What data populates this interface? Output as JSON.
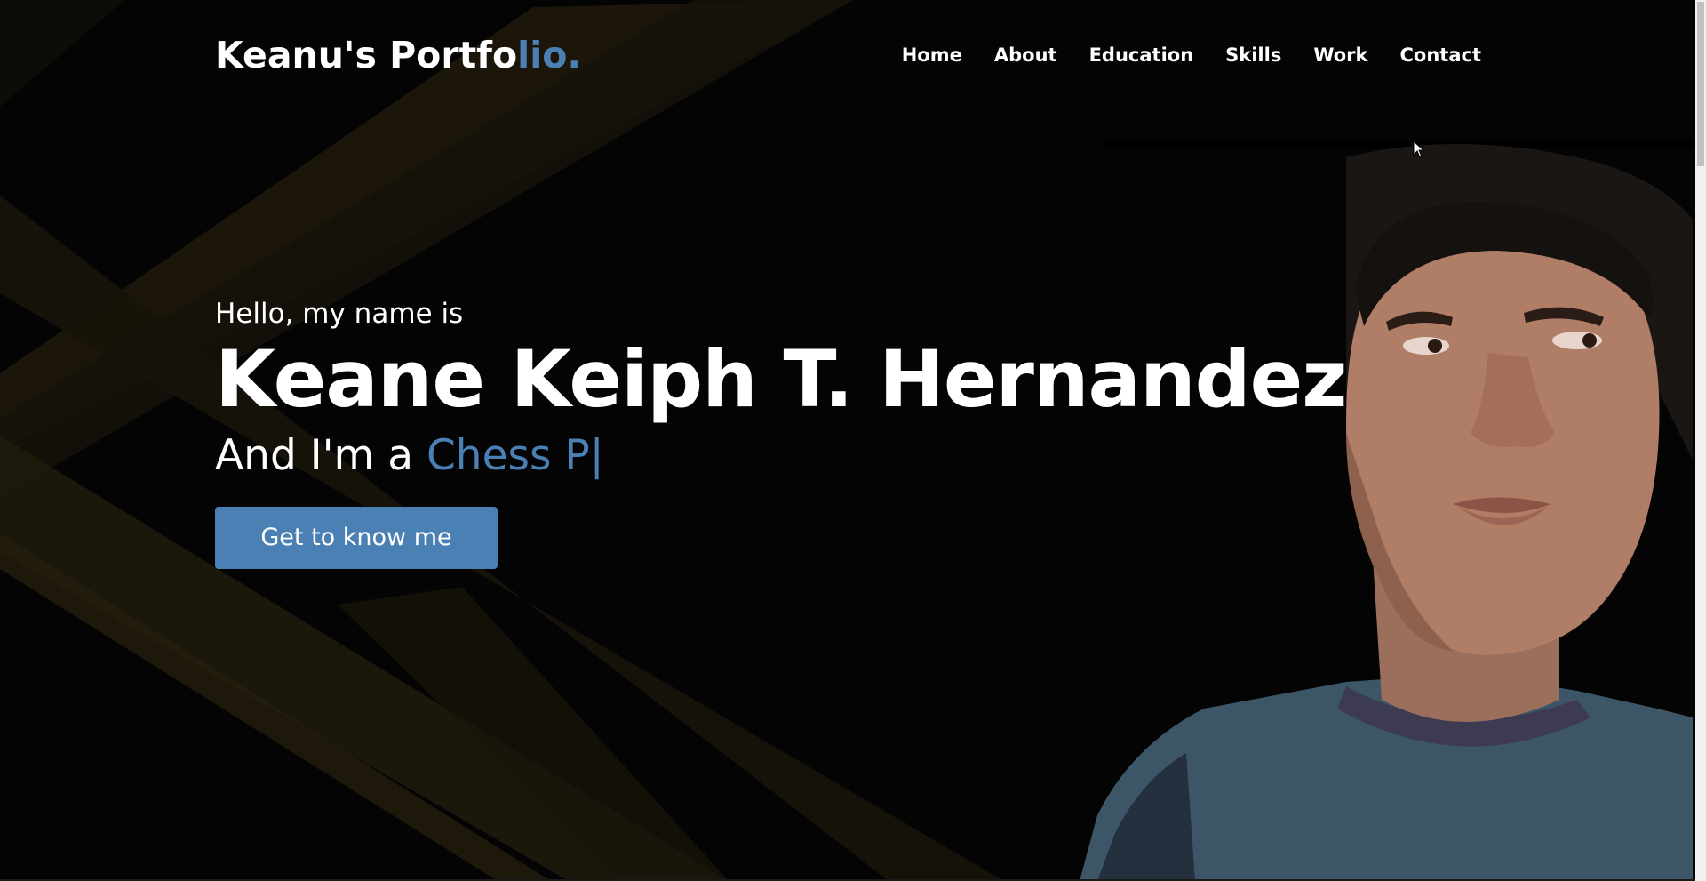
{
  "navbar": {
    "logo_main": "Keanu's Portfo",
    "logo_accent": "lio.",
    "links": [
      {
        "label": "Home"
      },
      {
        "label": "About"
      },
      {
        "label": "Education"
      },
      {
        "label": "Skills"
      },
      {
        "label": "Work"
      },
      {
        "label": "Contact"
      }
    ]
  },
  "hero": {
    "greeting": "Hello, my name is",
    "name": "Keane Keiph T. Hernandez",
    "role_prefix": "And I'm a ",
    "role_typed": "Chess P",
    "caret": "|",
    "cta_label": "Get to know me"
  },
  "colors": {
    "accent": "#4a80b4",
    "background": "#040404",
    "beam": "#2a230f"
  },
  "icons": {
    "cursor": "mouse-pointer-icon"
  }
}
